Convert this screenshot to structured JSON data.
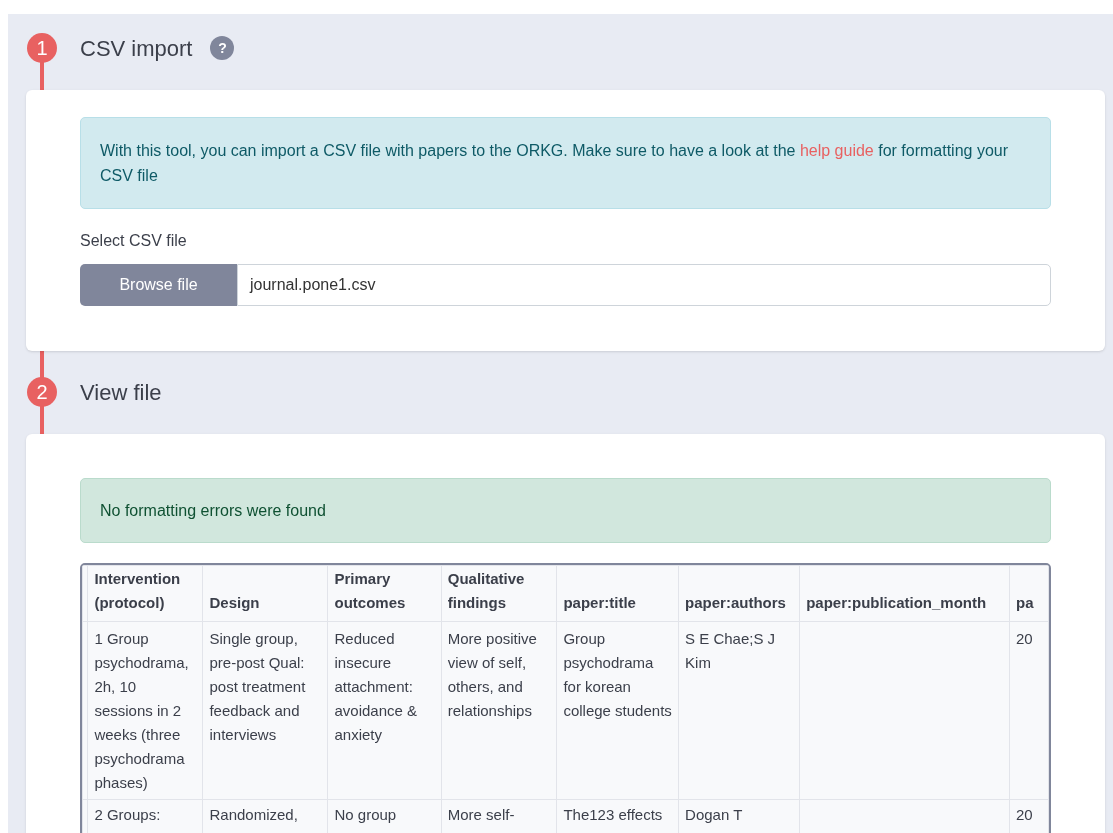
{
  "steps": [
    {
      "number": "1",
      "title": "CSV import",
      "help": "?",
      "alert": {
        "kind": "info",
        "text": "With this tool, you can import a CSV file with papers to the ORKG. Make sure to have a look at the ",
        "link": "help guide",
        "after": " for formatting your CSV file"
      },
      "file_label": "Select CSV file",
      "browse_button": "Browse file",
      "file_value": "journal.pone1.csv"
    },
    {
      "number": "2",
      "title": "View file",
      "alert": {
        "kind": "success",
        "text": "No formatting errors were found"
      },
      "table": {
        "columns": [
          "Intervention (protocol)",
          "Design",
          "Primary outcomes",
          "Qualitative findings",
          "paper:title",
          "paper:authors",
          "paper:publication_month",
          "pa"
        ],
        "rows": [
          {
            "cells": [
              "1 Group psychodrama, 2h, 10 sessions in 2 weeks (three psychodrama phases)",
              "Single group, pre-post Qual: post treatment feedback and interviews",
              "Reduced insecure attachment: avoidance & anxiety",
              "More positive view of self, others, and relationships",
              "Group psychodrama for korean college students",
              "S E Chae;S J Kim",
              null,
              "20"
            ]
          },
          {
            "cells": [
              "2 Groups:",
              "Randomized,",
              "No group",
              "More self-",
              "The123 effects",
              "Dogan T",
              null,
              "20"
            ]
          }
        ]
      }
    }
  ]
}
